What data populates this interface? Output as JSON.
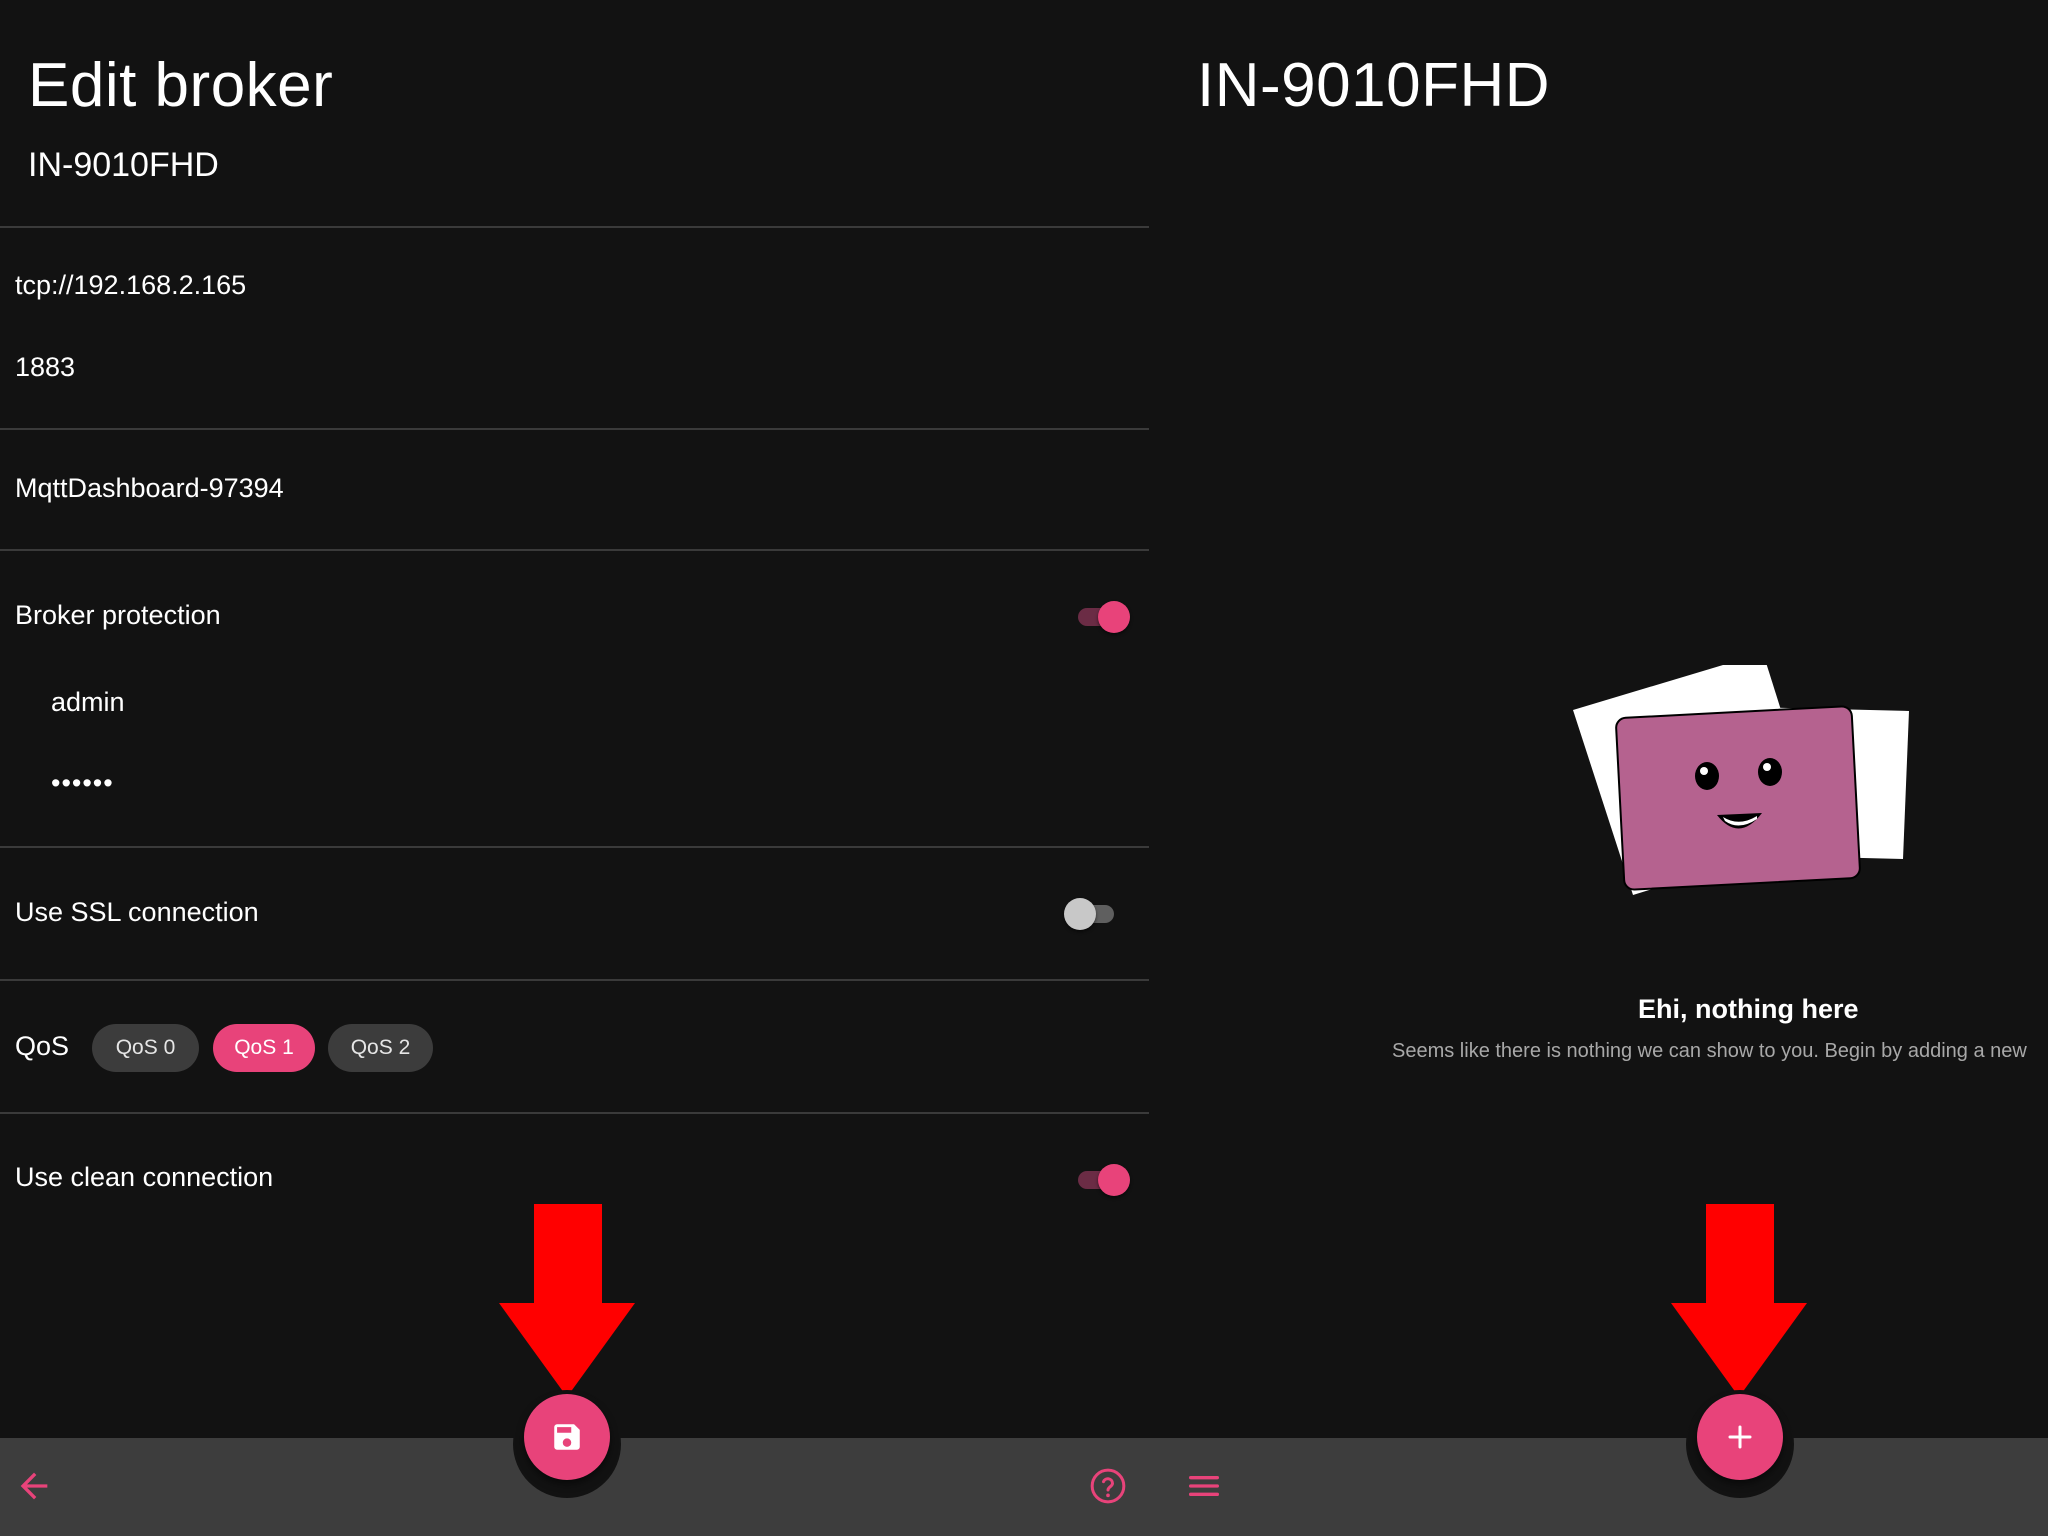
{
  "left_screen": {
    "title": "Edit broker",
    "subtitle": "IN-9010FHD",
    "address": "tcp://192.168.2.165",
    "port": "1883",
    "client_id": "MqttDashboard-97394",
    "broker_protection": {
      "label": "Broker protection",
      "enabled": true,
      "username": "admin",
      "password_mask": "••••••"
    },
    "ssl": {
      "label": "Use SSL connection",
      "enabled": false
    },
    "qos": {
      "label": "QoS",
      "options": [
        "QoS 0",
        "QoS 1",
        "QoS 2"
      ],
      "selected": "QoS 1"
    },
    "clean_connection": {
      "label": "Use clean connection",
      "enabled": true
    },
    "fab_icon": "save-icon",
    "bottom_bar": {
      "left_icon": "arrow-back-icon",
      "right_icon": "help-circle-icon"
    }
  },
  "right_screen": {
    "title": "IN-9010FHD",
    "empty_state": {
      "title": "Ehi, nothing here",
      "description": "Seems like there is nothing we can show to you. Begin by adding a new"
    },
    "fab_icon": "plus-icon",
    "bottom_bar": {
      "left_icon": "menu-icon"
    }
  },
  "colors": {
    "background": "#121212",
    "accent": "#e8437a",
    "bottom_bar": "#3d3d3d",
    "annotation_arrow": "#ff0000",
    "illustration_card": "#b5628f"
  }
}
